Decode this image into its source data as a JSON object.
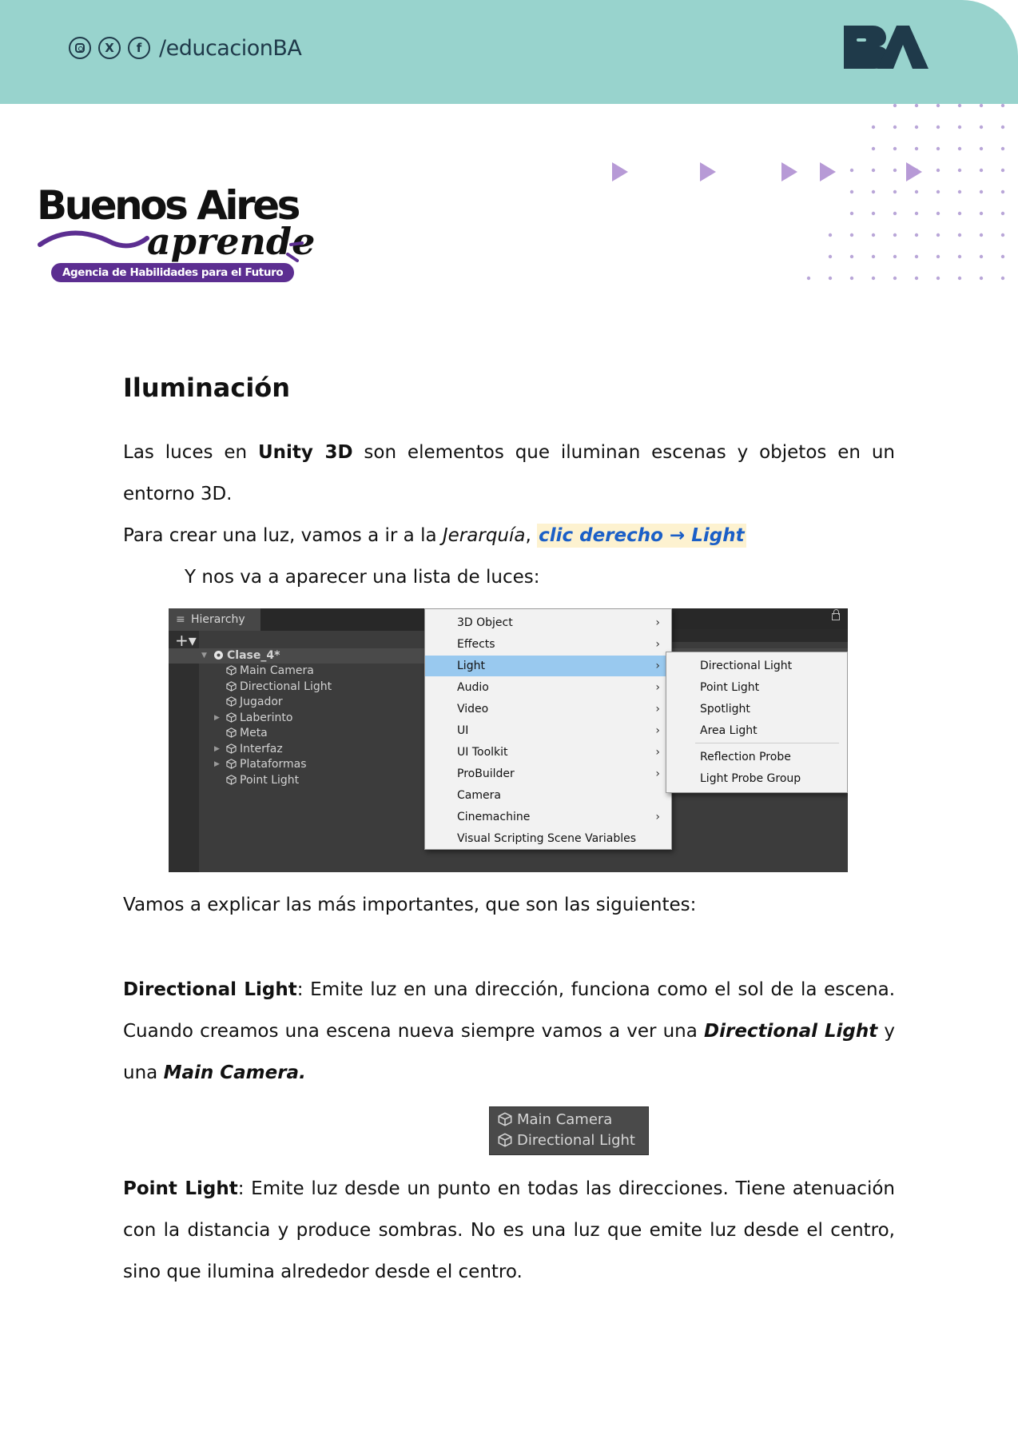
{
  "header": {
    "social_handle": "/educacionBA",
    "social_icons": [
      "instagram-icon",
      "x-icon",
      "facebook-icon"
    ],
    "logo_text": "BA",
    "band_color": "#98d3cd"
  },
  "brand": {
    "title": "Buenos Aires",
    "script": "aprende",
    "tagline": "Agencia de Habilidades para el Futuro",
    "accent": "#5c2e91"
  },
  "section": {
    "title": "Iluminación",
    "intro": {
      "t1": "Las luces en ",
      "b1": "Unity 3D",
      "t2": " son elementos que iluminan escenas y objetos en un entorno 3D."
    },
    "create": {
      "t1": "Para crear una luz, vamos a ir a la ",
      "i1": "Jerarquía",
      "t2": ", ",
      "hl": "clic derecho → Light"
    },
    "list_intro": "Y nos va a aparecer una lista de luces:",
    "explain": "Vamos a explicar las más importantes, que son las siguientes:",
    "directional": {
      "label": "Directional Light",
      "t1": ": Emite luz en una dirección, funciona como el sol de la escena. Cuando creamos una escena nueva siempre vamos a ver una ",
      "b1": "Directional Light",
      "t2": " y una ",
      "b2": "Main Camera."
    },
    "point": {
      "label": "Point Light",
      "t1": ": Emite luz desde un punto en todas las direcciones. Tiene atenuación con la distancia y produce sombras. No es una luz que emite luz desde el centro, sino que ilumina alrededor desde el centro."
    }
  },
  "unity": {
    "hierarchy_tab": "Hierarchy",
    "plus": "+▾",
    "scene": "Clase_4*",
    "items": [
      "Main Camera",
      "Directional Light",
      "Jugador",
      "Laberinto",
      "Meta",
      "Interfaz",
      "Plataformas",
      "Point Light"
    ],
    "menu": [
      "3D Object",
      "Effects",
      "Light",
      "Audio",
      "Video",
      "UI",
      "UI Toolkit",
      "ProBuilder",
      "Camera",
      "Cinemachine",
      "Visual Scripting Scene Variables"
    ],
    "menu_selected": "Light",
    "submenu": [
      "Directional Light",
      "Point Light",
      "Spotlight",
      "Area Light",
      "Reflection Probe",
      "Light Probe Group"
    ],
    "mini_items": [
      "Main Camera",
      "Directional Light"
    ],
    "selection_color": "#99c9ef"
  }
}
